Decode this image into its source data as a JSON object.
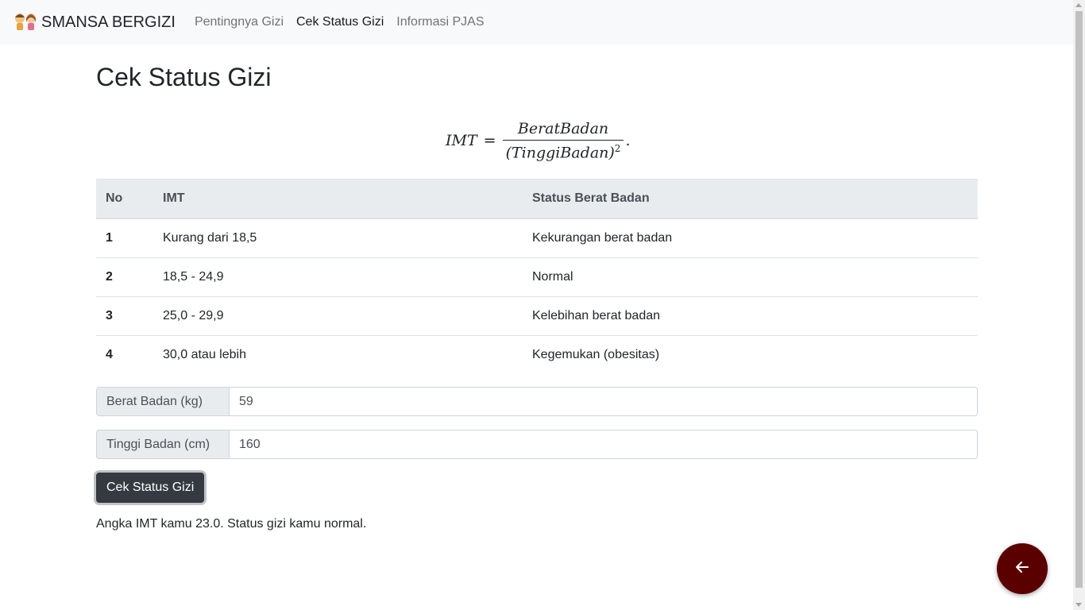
{
  "navbar": {
    "brand": "SMANSA BERGIZI",
    "links": [
      {
        "label": "Pentingnya Gizi"
      },
      {
        "label": "Cek Status Gizi"
      },
      {
        "label": "Informasi PJAS"
      }
    ]
  },
  "main": {
    "title": "Cek Status Gizi",
    "formula": {
      "lhs": "IMT",
      "equals": "=",
      "numerator": "BeratBadan",
      "denominator": "(TinggiBadan)",
      "exponent": "2",
      "period": "."
    },
    "table": {
      "headers": [
        "No",
        "IMT",
        "Status Berat Badan"
      ],
      "rows": [
        {
          "no": "1",
          "imt": "Kurang dari 18,5",
          "status": "Kekurangan berat badan"
        },
        {
          "no": "2",
          "imt": "18,5 - 24,9",
          "status": "Normal"
        },
        {
          "no": "3",
          "imt": "25,0 - 29,9",
          "status": "Kelebihan berat badan"
        },
        {
          "no": "4",
          "imt": "30,0 atau lebih",
          "status": "Kegemukan (obesitas)"
        }
      ]
    },
    "form": {
      "berat_label": "Berat Badan (kg)",
      "berat_value": "59",
      "tinggi_label": "Tinggi Badan (cm)",
      "tinggi_value": "160",
      "button_label": "Cek Status Gizi"
    },
    "result": "Angka IMT kamu 23.0. Status gizi kamu normal."
  },
  "colors": {
    "navbar_bg": "#f8f9fa",
    "button_bg": "#343a40",
    "fab_bg": "#5a0000"
  },
  "icons": {
    "brand": "kids-logo-icon",
    "fab": "arrow-left-icon"
  }
}
